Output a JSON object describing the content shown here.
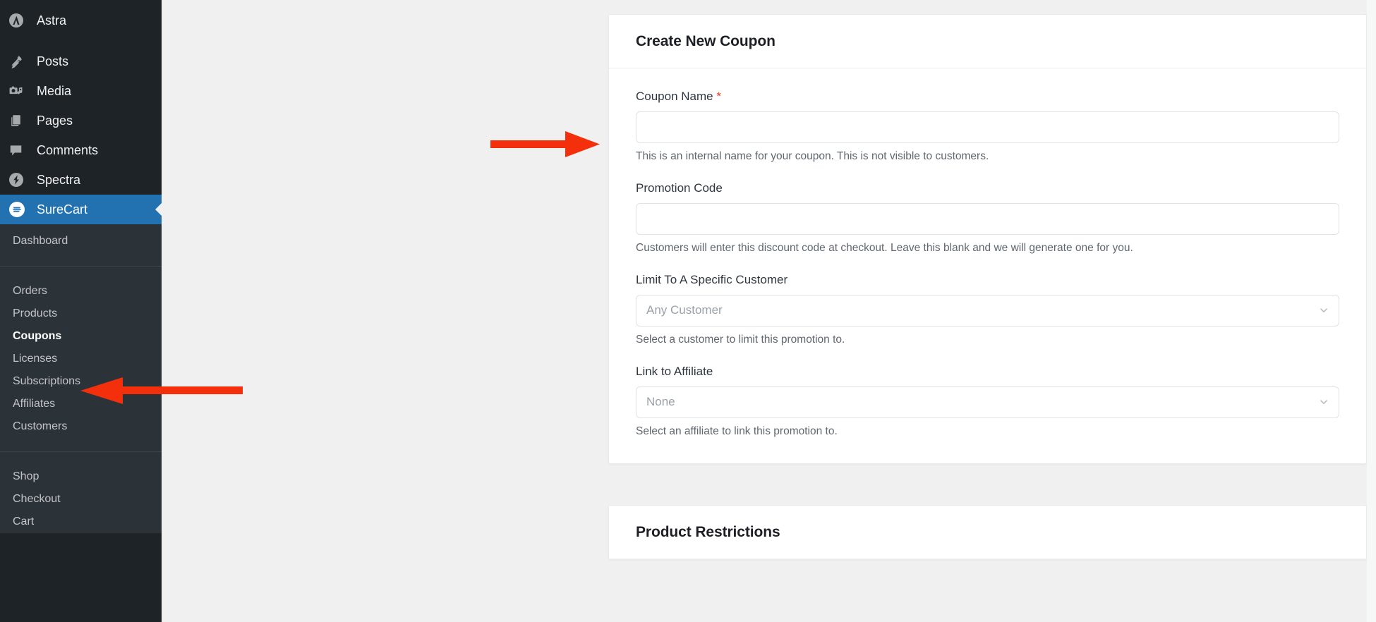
{
  "sidebar": {
    "top_items": [
      {
        "label": "Astra",
        "icon": "astra-logo-icon"
      },
      {
        "label": "Posts",
        "icon": "pushpin-icon"
      },
      {
        "label": "Media",
        "icon": "media-camera-icon"
      },
      {
        "label": "Pages",
        "icon": "pages-icon"
      },
      {
        "label": "Comments",
        "icon": "comment-bubble-icon"
      },
      {
        "label": "Spectra",
        "icon": "spectra-logo-icon"
      }
    ],
    "active_item": {
      "label": "SureCart",
      "icon": "surecart-logo-icon"
    },
    "dashboard_label": "Dashboard",
    "group_one": [
      "Orders",
      "Products",
      "Coupons",
      "Licenses",
      "Subscriptions",
      "Affiliates",
      "Customers"
    ],
    "current_submenu": "Coupons",
    "group_two": [
      "Shop",
      "Checkout",
      "Cart"
    ]
  },
  "coupon_card": {
    "title": "Create New Coupon",
    "fields": [
      {
        "label": "Coupon Name",
        "required": true,
        "type": "text",
        "value": "",
        "placeholder": "",
        "help": "This is an internal name for your coupon. This is not visible to customers."
      },
      {
        "label": "Promotion Code",
        "required": false,
        "type": "text",
        "value": "",
        "placeholder": "",
        "help": "Customers will enter this discount code at checkout. Leave this blank and we will generate one for you."
      },
      {
        "label": "Limit To A Specific Customer",
        "required": false,
        "type": "select",
        "value": "Any Customer",
        "help": "Select a customer to limit this promotion to."
      },
      {
        "label": "Link to Affiliate",
        "required": false,
        "type": "select",
        "value": "None",
        "help": "Select an affiliate to link this promotion to."
      }
    ]
  },
  "restrictions_card": {
    "title": "Product Restrictions"
  },
  "annotations": {
    "arrow_color": "#f4300c",
    "arrow_to_coupon_name": "points right toward the Coupon Name input",
    "arrow_to_coupons_menu": "points left toward the Coupons sidebar item"
  },
  "colors": {
    "sidebar_bg": "#1d2327",
    "submenu_bg": "#2c3338",
    "active_blue": "#2271b1",
    "page_bg": "#f0f0f1",
    "card_bg": "#ffffff",
    "required_red": "#e2401c",
    "annotation_red": "#f4300c"
  }
}
